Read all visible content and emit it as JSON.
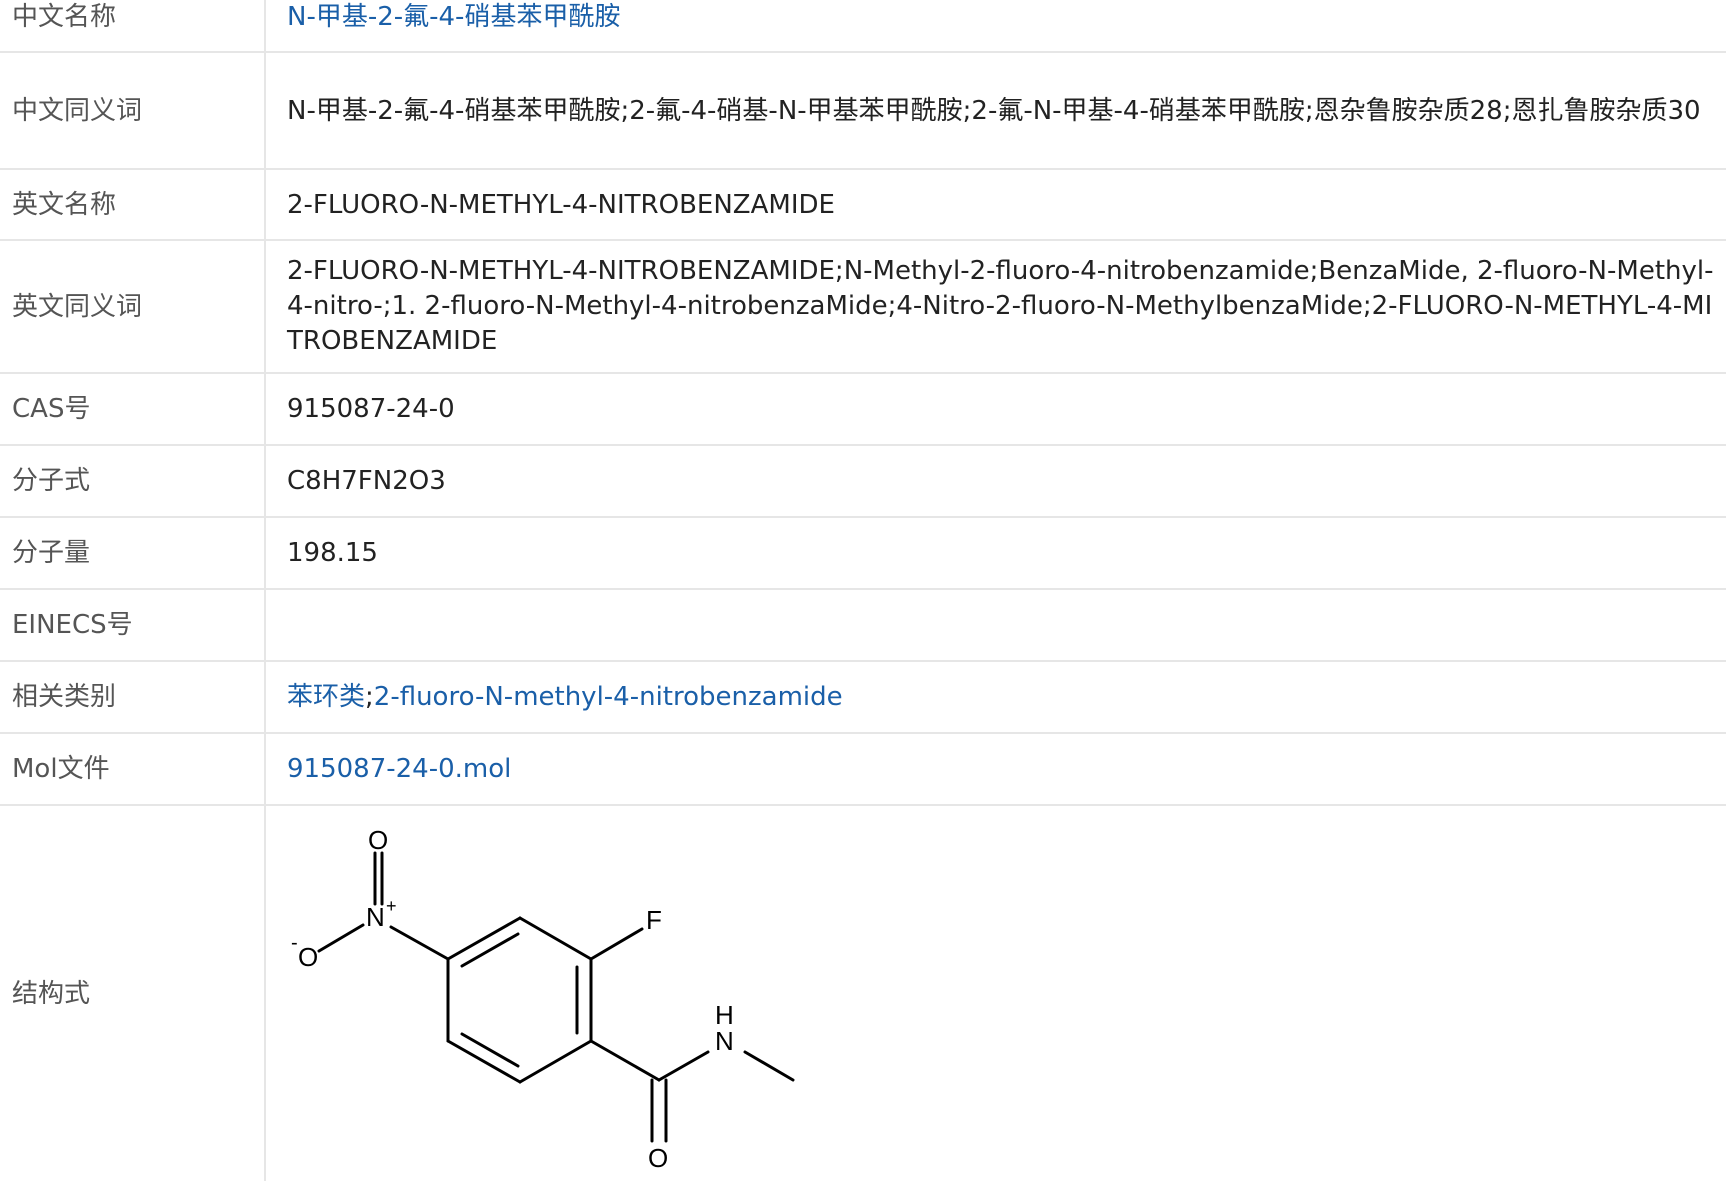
{
  "rows": {
    "chinese_name": {
      "label": "中文名称",
      "value": "N-甲基-2-氟-4-硝基苯甲酰胺"
    },
    "chinese_synonyms": {
      "label": "中文同义词",
      "value": "N-甲基-2-氟-4-硝基苯甲酰胺;2-氟-4-硝基-N-甲基苯甲酰胺;2-氟-N-甲基-4-硝基苯甲酰胺;恩杂鲁胺杂质28;恩扎鲁胺杂质30"
    },
    "english_name": {
      "label": "英文名称",
      "value": "2-FLUORO-N-METHYL-4-NITROBENZAMIDE"
    },
    "english_synonyms": {
      "label": "英文同义词",
      "value": "2-FLUORO-N-METHYL-4-NITROBENZAMIDE;N-Methyl-2-fluoro-4-nitrobenzamide;BenzaMide, 2-fluoro-N-Methyl-4-nitro-;1. 2-fluoro-N-Methyl-4-nitrobenzaMide;4-Nitro-2-fluoro-N-MethylbenzaMide;2-FLUORO-N-METHYL-4-MITROBENZAMIDE"
    },
    "cas": {
      "label": "CAS号",
      "value": "915087-24-0"
    },
    "formula": {
      "label": "分子式",
      "value": "C8H7FN2O3"
    },
    "mol_weight": {
      "label": "分子量",
      "value": "198.15"
    },
    "einecs": {
      "label": "EINECS号",
      "value": ""
    },
    "category": {
      "label": "相关类别",
      "links": [
        "苯环类",
        "2-fluoro-N-methyl-4-nitrobenzamide"
      ],
      "separator": ";"
    },
    "mol_file": {
      "label": "Mol文件",
      "value": "915087-24-0.mol"
    },
    "structure": {
      "label": "结构式",
      "atoms": {
        "o_top": "O",
        "n_nitro": "N",
        "plus": "+",
        "o_left": "O",
        "minus": "-",
        "f": "F",
        "h": "H",
        "n_amide": "N",
        "o_carbonyl": "O"
      }
    }
  },
  "colors": {
    "link": "#1a5fa8",
    "label_text": "#555555",
    "value_text": "#222222",
    "border": "#e6e6e6"
  }
}
